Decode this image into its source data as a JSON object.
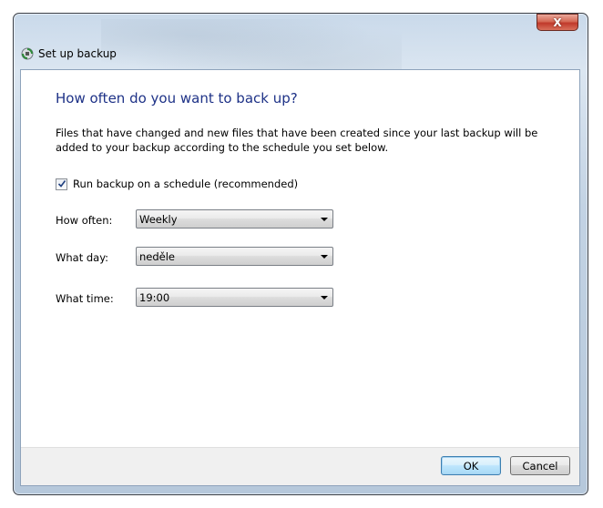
{
  "window": {
    "title": "Set up backup",
    "close_glyph": "X",
    "icon": "backup-icon"
  },
  "content": {
    "heading": "How often do you want to back up?",
    "description": "Files that have changed and new files that have been created since your last backup will be added to your backup according to the schedule you set below.",
    "schedule_checkbox": {
      "label": "Run backup on a schedule (recommended)",
      "checked": true
    },
    "fields": {
      "how_often": {
        "label": "How often:",
        "value": "Weekly"
      },
      "what_day": {
        "label": "What day:",
        "value": "neděle"
      },
      "what_time": {
        "label": "What time:",
        "value": "19:00"
      }
    }
  },
  "footer": {
    "ok_label": "OK",
    "cancel_label": "Cancel"
  },
  "colors": {
    "heading": "#1e3287",
    "close_button": "#c0392b",
    "default_button_border": "#3c7fb1"
  }
}
